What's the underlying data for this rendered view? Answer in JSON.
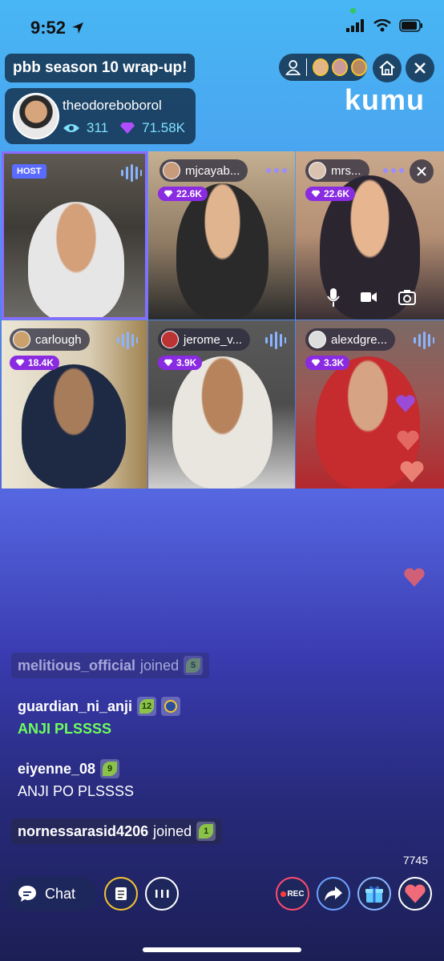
{
  "status": {
    "time": "9:52"
  },
  "header": {
    "title": "pbb season 10 wrap-up!",
    "host_name": "theodoreboborol",
    "viewers": "311",
    "gems": "71.58K",
    "logo": "kumu"
  },
  "tiles": [
    {
      "badge": "HOST"
    },
    {
      "name": "mjcayab...",
      "gems": "22.6K"
    },
    {
      "name": "mrs...",
      "gems": "22.6K"
    },
    {
      "name": "carlough",
      "gems": "18.4K"
    },
    {
      "name": "jerome_v...",
      "gems": "3.9K"
    },
    {
      "name": "alexdgre...",
      "gems": "3.3K"
    }
  ],
  "chat": [
    {
      "user": "melitious_official",
      "text": "joined",
      "badge": "5"
    },
    {
      "user": "guardian_ni_anji",
      "badge": "12",
      "message": "ANJI PLSSSS"
    },
    {
      "user": "eiyenne_08",
      "badge": "9",
      "message": "ANJI PO PLSSSS"
    },
    {
      "user": "nornessarasid4206",
      "text": "joined",
      "badge": "1"
    }
  ],
  "footer": {
    "chat_label": "Chat",
    "rec_label": "REC",
    "like_count": "7745"
  },
  "colors": {
    "accent_purple": "#8a2be2",
    "host_border": "#8a6bff",
    "green_message": "#6dff5a",
    "heart": "#f06a7a"
  }
}
